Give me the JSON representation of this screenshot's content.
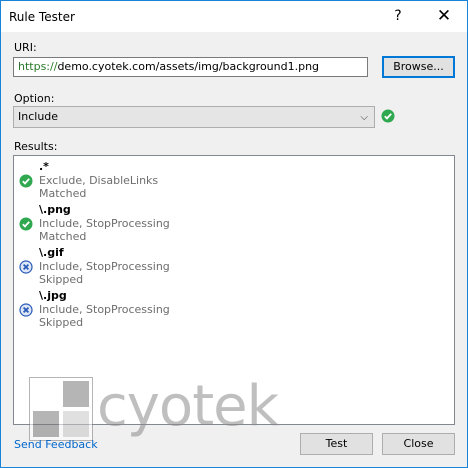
{
  "window": {
    "title": "Rule Tester",
    "help_glyph": "?",
    "close_glyph": "✕"
  },
  "uri": {
    "label": "URI:",
    "scheme": "https://",
    "rest": "demo.cyotek.com/assets/img/background1.png"
  },
  "browse_label": "Browse...",
  "option": {
    "label": "Option:",
    "selected": "Include",
    "status": "ok"
  },
  "results": {
    "label": "Results:",
    "rules": [
      {
        "pattern": ".*",
        "actions": "Exclude, DisableLinks",
        "status": "Matched",
        "icon": "check-icon"
      },
      {
        "pattern": "\\.png",
        "actions": "Include, StopProcessing",
        "status": "Matched",
        "icon": "check-icon"
      },
      {
        "pattern": "\\.gif",
        "actions": "Include, StopProcessing",
        "status": "Skipped",
        "icon": "cross-icon"
      },
      {
        "pattern": "\\.jpg",
        "actions": "Include, StopProcessing",
        "status": "Skipped",
        "icon": "cross-icon"
      }
    ]
  },
  "logo_text": "cyotek",
  "feedback_link": "Send Feedback",
  "buttons": {
    "test": "Test",
    "close": "Close"
  },
  "colors": {
    "accent": "#0078d7",
    "ok": "#2fa84f",
    "skip": "#2a5bb8",
    "link": "#0066cc"
  }
}
